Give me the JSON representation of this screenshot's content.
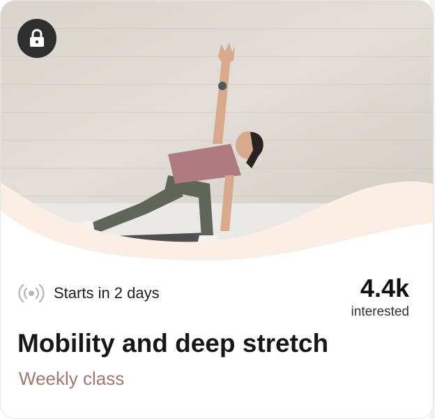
{
  "card": {
    "hero_image": "yoga-side-plank-stretch-photo",
    "lock_icon": "lock-icon",
    "live_icon": "live-broadcast-icon",
    "status_text": "Starts in 2 days",
    "interested_count": "4.4k",
    "interested_label": "interested",
    "title": "Mobility and deep stretch",
    "subtitle": "Weekly class"
  },
  "colors": {
    "wave": "#fbeee4",
    "subtitle": "#a37670",
    "lock_badge": "#2f2f2f",
    "live_icon": "#b8b8b8"
  }
}
